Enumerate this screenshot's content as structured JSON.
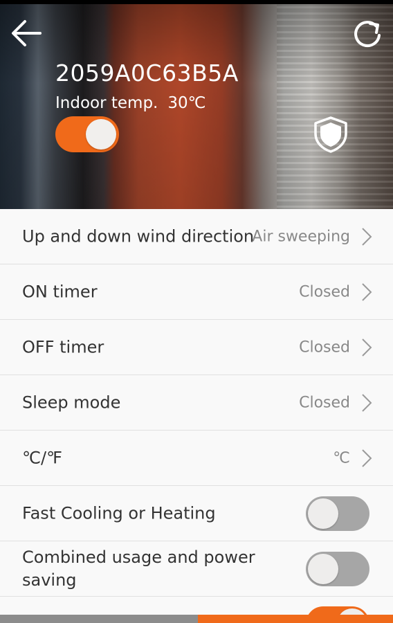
{
  "header": {
    "device_name": "2059A0C63B5A",
    "indoor_label": "Indoor temp.",
    "indoor_value": "30℃",
    "power_on": true
  },
  "settings": {
    "wind_direction": {
      "label": "Up and down wind direction",
      "value": "Air sweeping"
    },
    "on_timer": {
      "label": "ON timer",
      "value": "Closed"
    },
    "off_timer": {
      "label": "OFF timer",
      "value": "Closed"
    },
    "sleep_mode": {
      "label": "Sleep mode",
      "value": "Closed"
    },
    "unit": {
      "label": "℃/℉",
      "value": "℃"
    },
    "fast_cooling": {
      "label": "Fast Cooling or Heating",
      "on": false
    },
    "combined_usage": {
      "label": "Combined usage and power saving",
      "on": false
    }
  },
  "colors": {
    "accent": "#f06a1a",
    "toggle_off": "#a6a6a6"
  },
  "icons": [
    "back-arrow-icon",
    "refresh-icon",
    "shield-icon",
    "chevron-right-icon"
  ]
}
